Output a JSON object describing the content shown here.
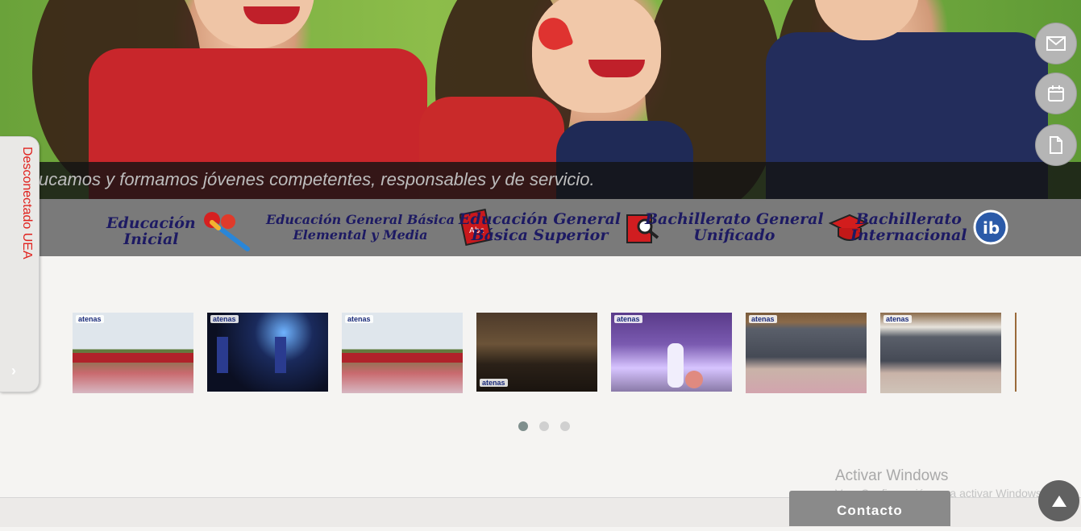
{
  "hero": {
    "slogan": "ucamos y formamos jóvenes competentes, responsables y de servicio."
  },
  "floating_actions": [
    {
      "icon": "envelope-icon"
    },
    {
      "icon": "calendar-icon"
    },
    {
      "icon": "document-icon"
    }
  ],
  "levels": [
    {
      "line1": "Educación",
      "line2": "Inicial",
      "icon": "hands-brush-icon"
    },
    {
      "line1": "Educación General Básica",
      "line2": "Elemental y Media",
      "icon": "abc-book-icon",
      "book_text": "Abc"
    },
    {
      "line1": "Educación General",
      "line2": "Básica Superior",
      "icon": "magnifier-book-icon"
    },
    {
      "line1": "Bachillerato General",
      "line2": "Unificado",
      "icon": "graduation-cap-icon"
    },
    {
      "line1": "Bachillerato",
      "line2": "Internacional",
      "icon": "ib-logo-icon",
      "logo_text": "ib"
    }
  ],
  "side_panel": {
    "label": "Desconectado UEA",
    "arrow": "›"
  },
  "gallery": {
    "thumb_logo": "atenas",
    "thumbnails": [
      {
        "scene": "outdoor parade on patio"
      },
      {
        "scene": "night stage with lights"
      },
      {
        "scene": "outdoor parade on patio"
      },
      {
        "scene": "audience in auditorium"
      },
      {
        "scene": "stage performance with balloons"
      },
      {
        "scene": "crowd in grandstand"
      },
      {
        "scene": "crowd in grandstand"
      }
    ],
    "pages": 3,
    "active_page": 1
  },
  "contact_button": "Contacto",
  "windows_watermark": {
    "title": "Activar Windows",
    "subtitle": "Ve a Configuración para activar Windows."
  },
  "colors": {
    "side_label": "#e0211d",
    "level_text": "#1d1a63",
    "levels_bar": "#7a7a7a"
  }
}
